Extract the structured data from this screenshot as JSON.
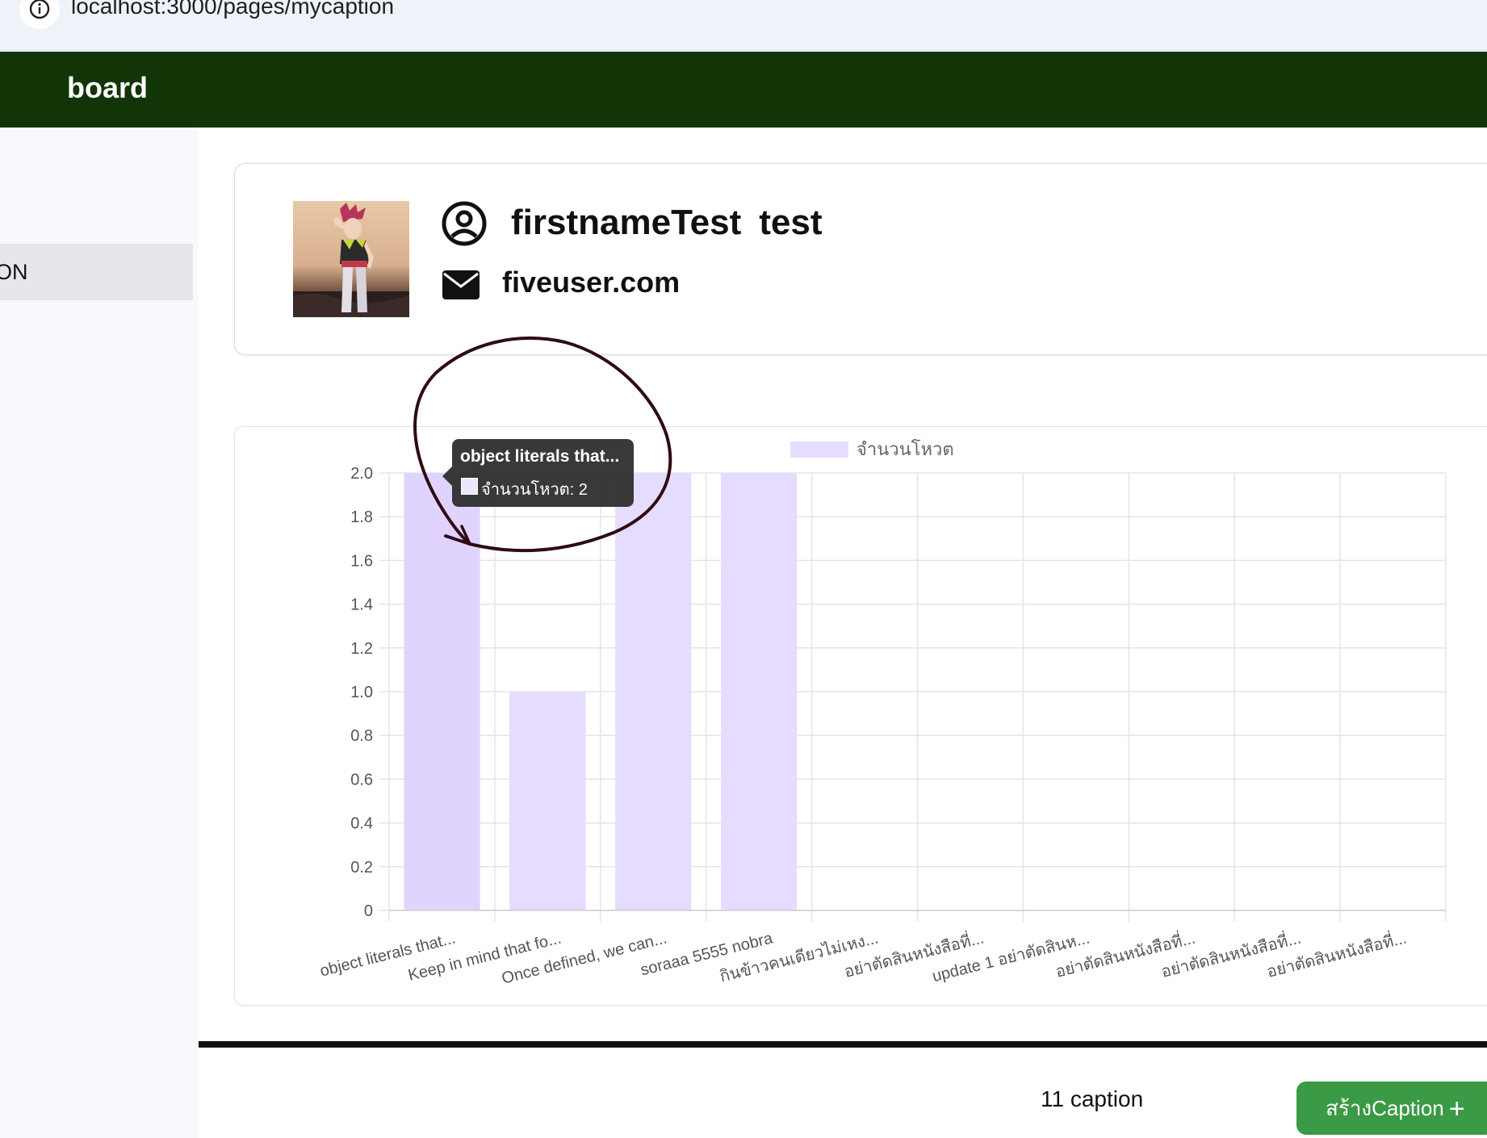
{
  "browser": {
    "url": "localhost:3000/pages/mycaption"
  },
  "header": {
    "title": "board"
  },
  "sidebar": {
    "items": [
      {
        "label": "ON",
        "active": true
      }
    ]
  },
  "profile": {
    "first_name": "firstnameTest",
    "last_name": "test",
    "email": "fiveuser.com",
    "icons": {
      "name": "user-circle-icon",
      "email": "envelope-icon"
    }
  },
  "chart_data": {
    "type": "bar",
    "categories": [
      "object literals that...",
      "Keep in mind that fo...",
      "Once defined, we can...",
      "soraaa 5555 nobra",
      "กินข้าวคนเดียวไม่เหง...",
      "อย่าตัดสินหนังสือที่...",
      "update 1 อย่าตัดสินห...",
      "อย่าตัดสินหนังสือที่...",
      "อย่าตัดสินหนังสือที่...",
      "อย่าตัดสินหนังสือที่..."
    ],
    "series": [
      {
        "name": "จำนวนโหวต",
        "values": [
          2,
          1,
          2,
          2,
          0,
          0,
          0,
          0,
          0,
          0
        ]
      }
    ],
    "yticks": [
      "0",
      "0.2",
      "0.4",
      "0.6",
      "0.8",
      "1.0",
      "1.2",
      "1.4",
      "1.6",
      "1.8",
      "2.0"
    ],
    "ylim": [
      0,
      2
    ],
    "grid": true,
    "legend_position": "top",
    "colors": {
      "bar": "#e6dcff",
      "bar_hover": "#e0d4ff",
      "grid": "#e5e5e5"
    }
  },
  "tooltip": {
    "title": "object literals that...",
    "body": "จำนวนโหวต: 2"
  },
  "footer": {
    "caption_count": "11 caption",
    "create_label": "สร้างCaption",
    "create_plus": "+"
  },
  "colors": {
    "header_bg": "#123507",
    "button_bg": "#3a9a45",
    "annotation": "#2e0c16"
  }
}
